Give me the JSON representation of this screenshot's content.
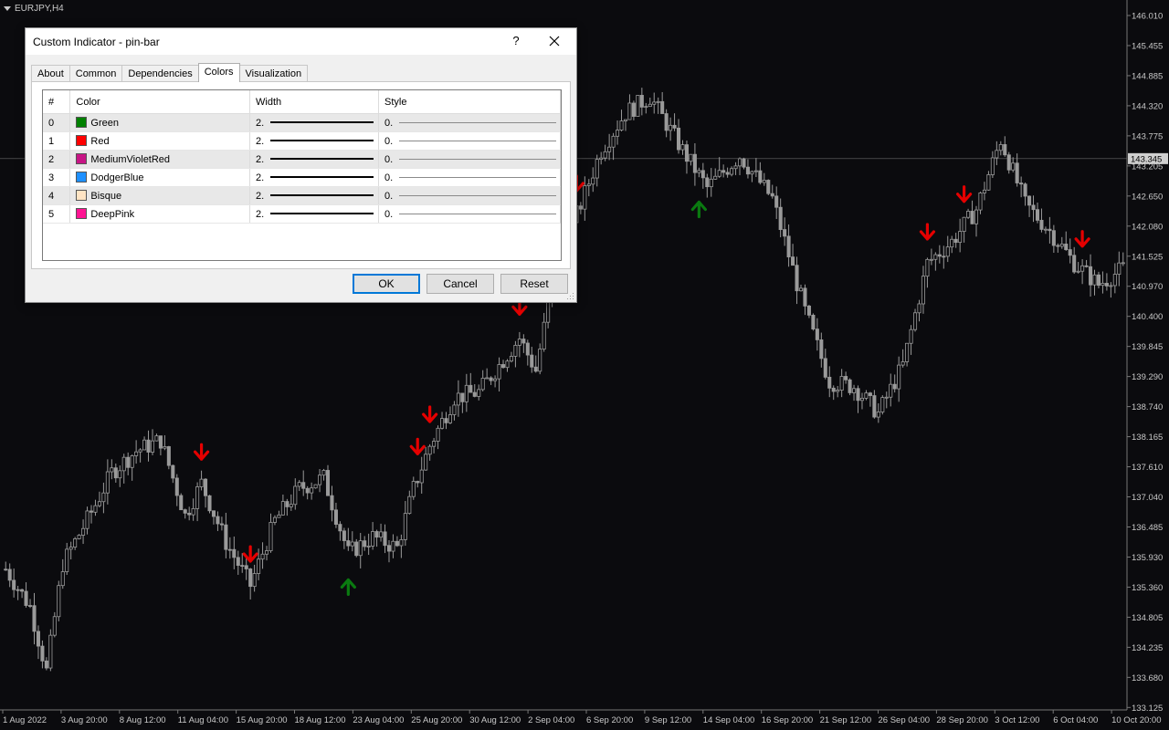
{
  "chart": {
    "symbol": "EURJPY,H4",
    "current_price": "143.345",
    "price_labels": [
      "146.010",
      "145.455",
      "144.885",
      "144.320",
      "143.775",
      "143.205",
      "142.650",
      "142.080",
      "141.525",
      "140.970",
      "140.400",
      "139.845",
      "139.290",
      "138.740",
      "138.165",
      "137.610",
      "137.040",
      "136.485",
      "135.930",
      "135.360",
      "134.805",
      "134.235",
      "133.680",
      "133.125"
    ],
    "date_labels": [
      "1 Aug 2022",
      "3 Aug 20:00",
      "8 Aug 12:00",
      "11 Aug 04:00",
      "15 Aug 20:00",
      "18 Aug 12:00",
      "23 Aug 04:00",
      "25 Aug 20:00",
      "30 Aug 12:00",
      "2 Sep 04:00",
      "6 Sep 20:00",
      "9 Sep 12:00",
      "14 Sep 04:00",
      "16 Sep 20:00",
      "21 Sep 12:00",
      "26 Sep 04:00",
      "28 Sep 20:00",
      "3 Oct 12:00",
      "6 Oct 04:00",
      "10 Oct 20:00"
    ],
    "colors": {
      "background": "#0b0b0e",
      "candle": "#9a9a9a",
      "up_arrow": "#0a7a10",
      "down_arrow": "#e50000",
      "axis_text": "#c9c9c9"
    },
    "arrows": [
      {
        "type": "down",
        "bar_index": 48
      },
      {
        "type": "down",
        "bar_index": 60
      },
      {
        "type": "up",
        "bar_index": 84
      },
      {
        "type": "down",
        "bar_index": 101
      },
      {
        "type": "down",
        "bar_index": 104
      },
      {
        "type": "down",
        "bar_index": 126
      },
      {
        "type": "down",
        "bar_index": 140
      },
      {
        "type": "up",
        "bar_index": 170
      },
      {
        "type": "down",
        "bar_index": 226
      },
      {
        "type": "down",
        "bar_index": 235
      },
      {
        "type": "down",
        "bar_index": 264
      }
    ]
  },
  "dialog": {
    "title": "Custom Indicator - pin-bar",
    "help": "?",
    "tabs": [
      "About",
      "Common",
      "Dependencies",
      "Colors",
      "Visualization"
    ],
    "active_tab": "Colors",
    "columns": [
      "#",
      "Color",
      "Width",
      "Style"
    ],
    "rows": [
      {
        "index": "0",
        "name": "Green",
        "color": "#008000",
        "width": "2.",
        "style": "0."
      },
      {
        "index": "1",
        "name": "Red",
        "color": "#ff0000",
        "width": "2.",
        "style": "0."
      },
      {
        "index": "2",
        "name": "MediumVioletRed",
        "color": "#c71585",
        "width": "2.",
        "style": "0."
      },
      {
        "index": "3",
        "name": "DodgerBlue",
        "color": "#1e90ff",
        "width": "2.",
        "style": "0."
      },
      {
        "index": "4",
        "name": "Bisque",
        "color": "#ffe4c4",
        "width": "2.",
        "style": "0."
      },
      {
        "index": "5",
        "name": "DeepPink",
        "color": "#ff1493",
        "width": "2.",
        "style": "0."
      }
    ],
    "buttons": {
      "ok": "OK",
      "cancel": "Cancel",
      "reset": "Reset"
    }
  }
}
